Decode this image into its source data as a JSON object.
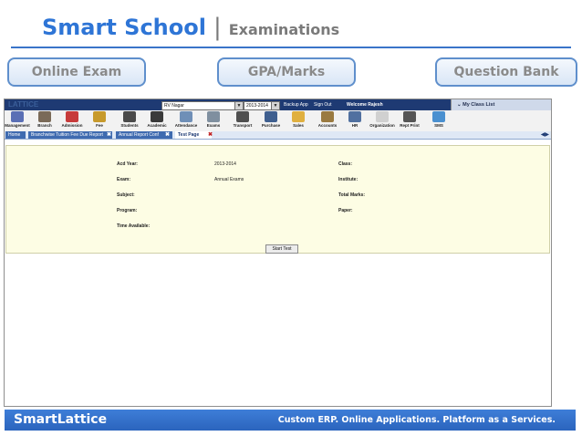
{
  "header": {
    "brand": "Smart School",
    "separator": "|",
    "section": "Examinations"
  },
  "nav_pills": [
    "Online Exam",
    "GPA/Marks",
    "Question Bank"
  ],
  "app": {
    "logo_text": "LATTICE",
    "topbar": {
      "branch_select": "RV Nagar",
      "year_select": "2013-2014",
      "backup_label": "Backup App",
      "signout_label": "Sign Out",
      "welcome": "Welcome Rajesh",
      "class_list": "My Class List"
    },
    "toolbar": [
      {
        "label": "Management",
        "icon": "management-icon",
        "color": "#5a6fb5"
      },
      {
        "label": "Branch",
        "icon": "branch-icon",
        "color": "#7a6a58"
      },
      {
        "label": "Admission",
        "icon": "admission-icon",
        "color": "#c73b3b"
      },
      {
        "label": "Fee",
        "icon": "fee-icon",
        "color": "#c79a2c"
      },
      {
        "label": "Students",
        "icon": "students-icon",
        "color": "#4a4a4a"
      },
      {
        "label": "Academic",
        "icon": "academic-icon",
        "color": "#3a3a3a"
      },
      {
        "label": "Attendance",
        "icon": "attendance-icon",
        "color": "#6f8fb7"
      },
      {
        "label": "Exams",
        "icon": "exams-icon",
        "color": "#7f8f9f"
      },
      {
        "label": "Transport",
        "icon": "transport-icon",
        "color": "#4f4f4f"
      },
      {
        "label": "Purchase",
        "icon": "purchase-icon",
        "color": "#3f5f8f"
      },
      {
        "label": "Sales",
        "icon": "sales-icon",
        "color": "#e0b040"
      },
      {
        "label": "Accounts",
        "icon": "accounts-icon",
        "color": "#9a7a40"
      },
      {
        "label": "HR",
        "icon": "hr-icon",
        "color": "#5070a0"
      },
      {
        "label": "Organization",
        "icon": "organization-icon",
        "color": "#d0d0d0"
      },
      {
        "label": "Rept Print",
        "icon": "printer-icon",
        "color": "#555555"
      },
      {
        "label": "SMS",
        "icon": "sms-icon",
        "color": "#4a90d0"
      }
    ],
    "tabs": [
      {
        "label": "Home"
      },
      {
        "label": "Branchwise Tuition Fee Due Report"
      },
      {
        "label": "Annual Report Conf"
      },
      {
        "label": "Test Page"
      }
    ],
    "tab_close": "✖",
    "nav_arrows": "◀▶",
    "form": {
      "acd_year_label": "Acd Year:",
      "acd_year_value": "2013-2014",
      "exam_label": "Exam:",
      "exam_value": "Annual Exams",
      "subject_label": "Subject:",
      "program_label": "Program:",
      "time_label": "Time Available:",
      "class_label": "Class:",
      "institute_label": "Institute:",
      "total_marks_label": "Total Marks:",
      "paper_label": "Paper:",
      "start_label": "Start Test"
    }
  },
  "footer": {
    "brand": "SmartLattice",
    "tagline": "Custom ERP. Online Applications. Platform as a Services."
  },
  "colors": {
    "brand_blue": "#2e75d6",
    "app_navy": "#1e3a73",
    "form_bg": "#fdfde4",
    "footer_blue": "#3a78d2"
  }
}
